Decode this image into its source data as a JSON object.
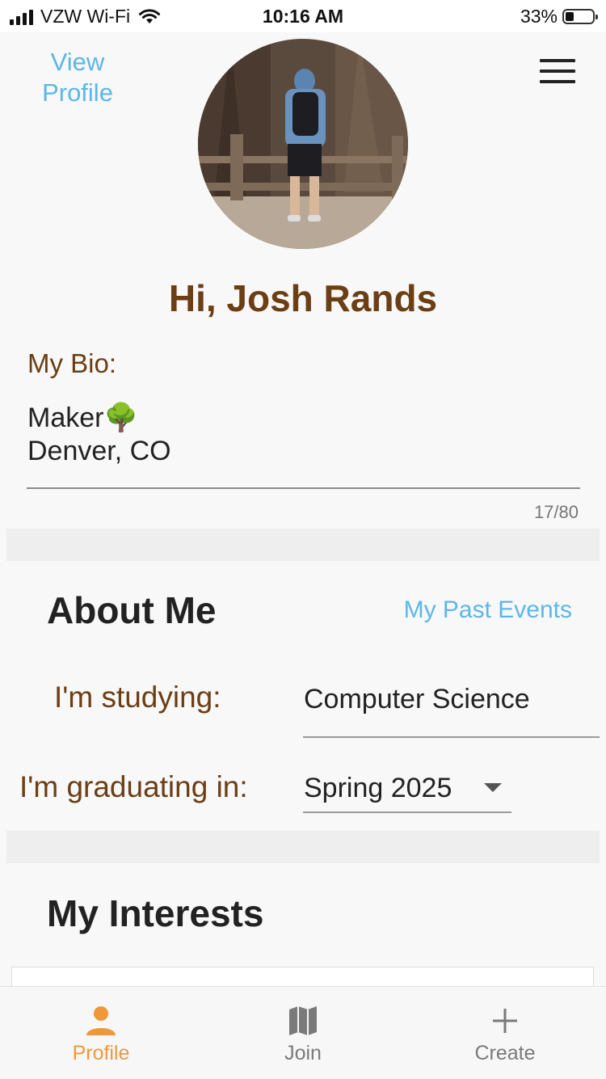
{
  "status_bar": {
    "carrier": "VZW Wi-Fi",
    "time": "10:16 AM",
    "battery": "33%"
  },
  "header": {
    "view_profile": "View Profile",
    "menu_icon": "hamburger-menu-icon",
    "avatar_icon": "profile-photo"
  },
  "greeting": "Hi, Josh Rands",
  "bio": {
    "label": "My Bio:",
    "line1": "Maker🌳",
    "line2": "Denver, CO",
    "counter": "17/80"
  },
  "about": {
    "title": "About Me",
    "past_events": "My Past Events",
    "studying_label": "I'm studying:",
    "studying_value": "Computer Science",
    "graduating_label": "I'm graduating in:",
    "graduating_value": "Spring 2025"
  },
  "interests": {
    "title": "My Interests"
  },
  "tabs": [
    {
      "label": "Profile",
      "icon": "person-icon",
      "active": true
    },
    {
      "label": "Join",
      "icon": "map-icon",
      "active": false
    },
    {
      "label": "Create",
      "icon": "plus-icon",
      "active": false
    }
  ],
  "colors": {
    "accent_blue": "#5bb7e8",
    "brown": "#6b3e14",
    "active_tab": "#f0973a",
    "inactive_tab": "#7a7a7a"
  }
}
